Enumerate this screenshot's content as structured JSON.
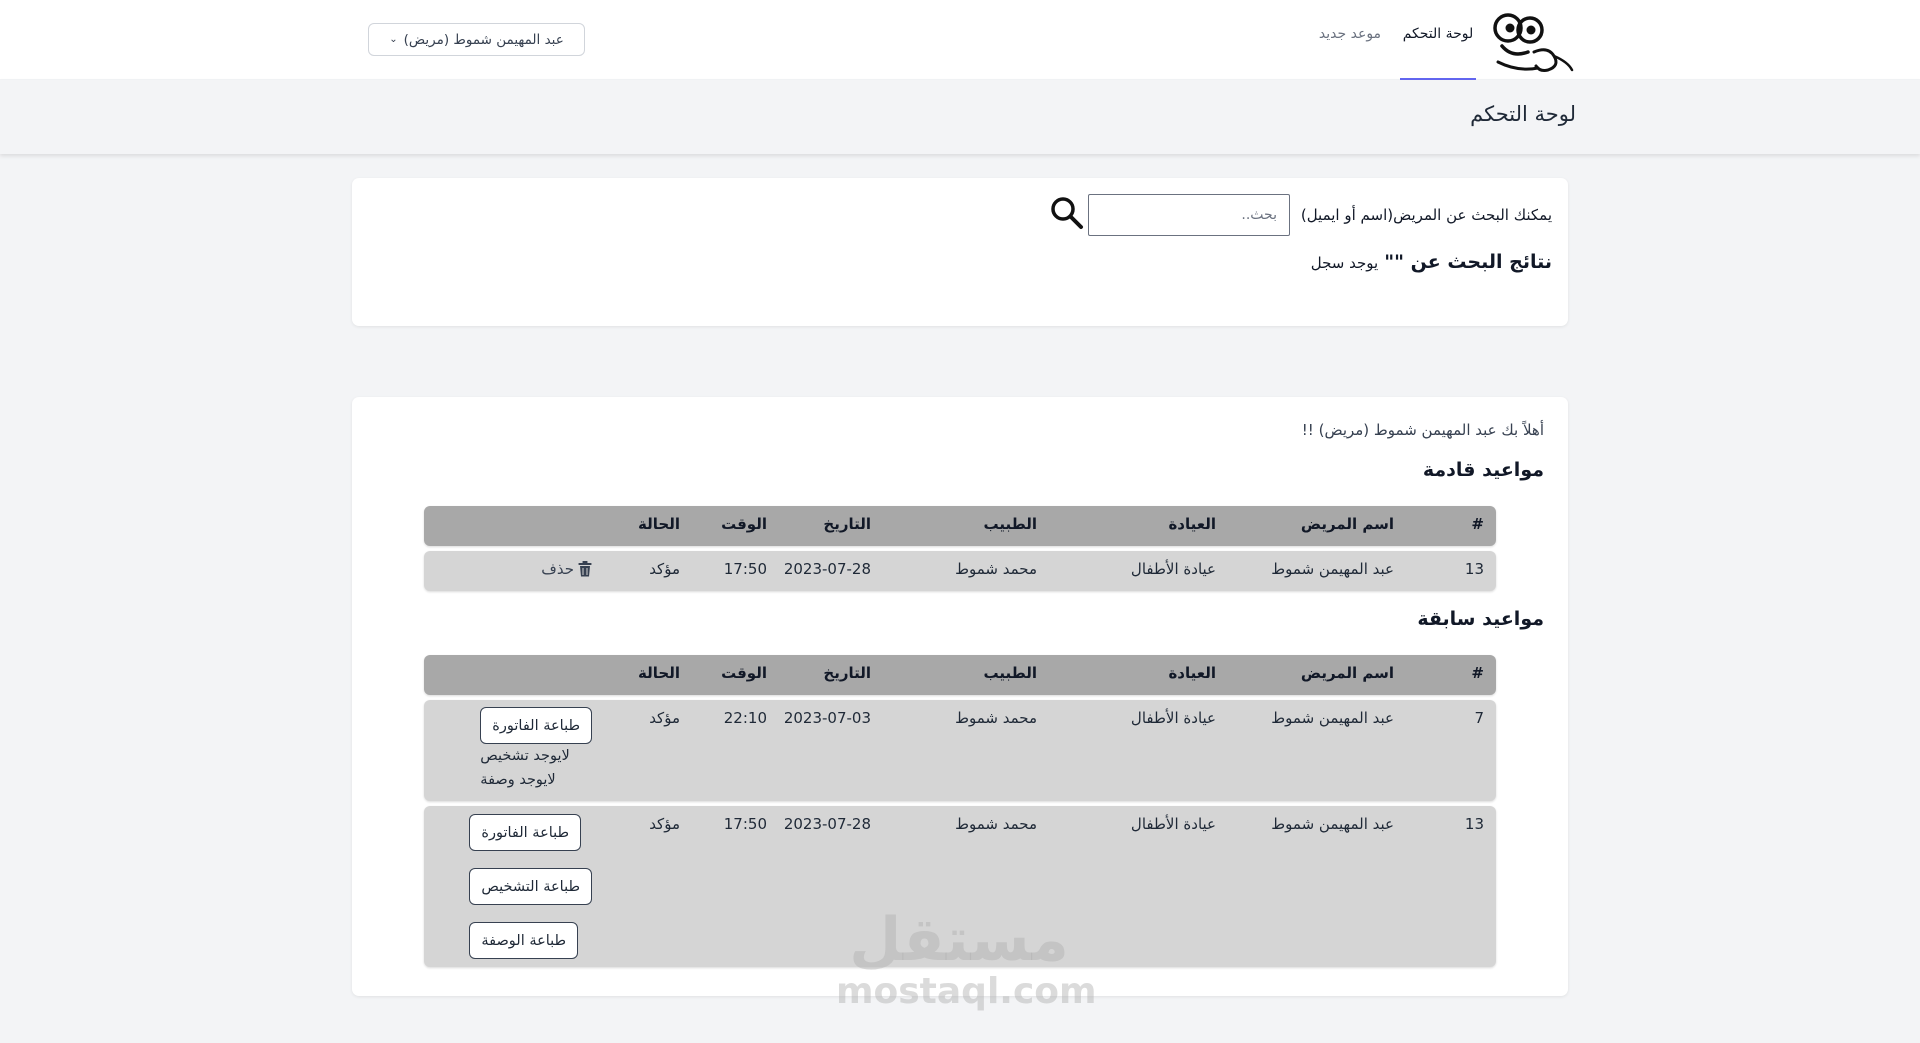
{
  "nav": {
    "dashboard": "لوحة التحكم",
    "new_appointment": "موعد جديد",
    "user_menu": "عبد المهيمن شموط (مريض)"
  },
  "header": {
    "title": "لوحة التحكم"
  },
  "search": {
    "label": "يمكنك البحث عن المريض(اسم أو ايميل)",
    "placeholder": "بحث..",
    "results_title": "نتائج البحث عن \"\"",
    "results_note": "يوجد سجل"
  },
  "welcome": "أهلاً بك عبد المهيمن شموط (مريض) !!",
  "columns": {
    "num": "#",
    "patient": "اسم المريض",
    "clinic": "العيادة",
    "doctor": "الطبيب",
    "date": "التاريخ",
    "time": "الوقت",
    "status": "الحالة"
  },
  "upcoming": {
    "title": "مواعيد قادمة",
    "rows": [
      {
        "num": "13",
        "patient": "عبد المهيمن شموط",
        "clinic": "عيادة الأطفال",
        "doctor": "محمد شموط",
        "date": "2023-07-28",
        "time": "17:50",
        "status": "مؤكد",
        "delete_label": "حذف"
      }
    ]
  },
  "past": {
    "title": "مواعيد سابقة",
    "rows": [
      {
        "num": "7",
        "patient": "عبد المهيمن شموط",
        "clinic": "عيادة الأطفال",
        "doctor": "محمد شموط",
        "date": "2023-07-03",
        "time": "22:10",
        "status": "مؤكد",
        "print_invoice": "طباعة الفاتورة",
        "no_diagnosis": "لايوجد تشخيص",
        "no_prescription": "لايوجد وصفة"
      },
      {
        "num": "13",
        "patient": "عبد المهيمن شموط",
        "clinic": "عيادة الأطفال",
        "doctor": "محمد شموط",
        "date": "2023-07-28",
        "time": "17:50",
        "status": "مؤكد",
        "print_invoice": "طباعة الفاتورة",
        "print_diagnosis": "طباعة التشخيص",
        "print_prescription": "طباعة الوصفة"
      }
    ]
  },
  "watermark": {
    "arabic": "مستقل",
    "latin": "mostaql.com"
  },
  "icons": {
    "logo": "cartoon-face-logo",
    "search": "search-icon",
    "delete": "trash-icon",
    "dropdown": "chevron-down-icon"
  }
}
